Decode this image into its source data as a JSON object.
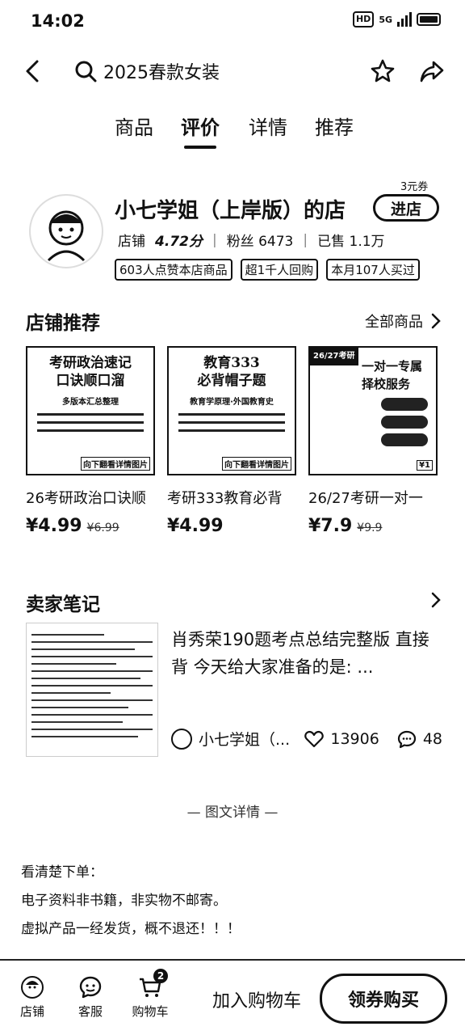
{
  "status_bar": {
    "time": "14:02",
    "hd": "HD",
    "network": "5G"
  },
  "search": {
    "query": "2025春款女装"
  },
  "tabs": [
    {
      "label": "商品"
    },
    {
      "label": "评价"
    },
    {
      "label": "详情"
    },
    {
      "label": "推荐"
    }
  ],
  "shop": {
    "name": "小七学姐（上岸版）的店",
    "coupon": "3元券",
    "enter_label": "进店",
    "rating_label": "店铺",
    "rating": "4.72分",
    "fans": "粉丝 6473",
    "sold": "已售 1.1万",
    "badges": [
      "603人点赞本店商品",
      "超1千人回购",
      "本月107人买过"
    ]
  },
  "recommend": {
    "title": "店铺推荐",
    "all_label": "全部商品",
    "products": [
      {
        "thumb_title_1": "考研政治速记",
        "thumb_title_2": "口诀顺口溜",
        "thumb_sub": "多版本汇总整理",
        "thumb_footer": "向下翻看详情图片",
        "name": "26考研政治口诀顺",
        "price": "¥4.99",
        "old_price": "¥6.99"
      },
      {
        "thumb_title_1": "教育333",
        "thumb_title_2": "必背帽子题",
        "thumb_sub": "教育学原理·外国教育史",
        "thumb_footer": "向下翻看详情图片",
        "name": "考研333教育必背",
        "price": "¥4.99",
        "old_price": ""
      },
      {
        "thumb_banner": "26/27考研",
        "thumb_title_1": "一对一专属",
        "thumb_title_2": "择校服务",
        "thumb_footer": "¥1",
        "name": "26/27考研一对一",
        "price": "¥7.9",
        "old_price": "¥9.9"
      }
    ]
  },
  "notes": {
    "title": "卖家笔记",
    "text": "肖秀荣190题考点总结完整版 直接背 今天给大家准备的是: ...",
    "author": "小七学姐（...",
    "likes": "13906",
    "comments": "48"
  },
  "detail": {
    "divider": "— 图文详情 —",
    "lines": [
      "看清楚下单：",
      "电子资料非书籍，非实物不邮寄。",
      "虚拟产品一经发货，概不退还！！！"
    ]
  },
  "bottom_bar": {
    "shop_label": "店铺",
    "service_label": "客服",
    "cart_label": "购物车",
    "cart_count": "2",
    "add_cart_label": "加入购物车",
    "buy_label": "领券购买"
  }
}
